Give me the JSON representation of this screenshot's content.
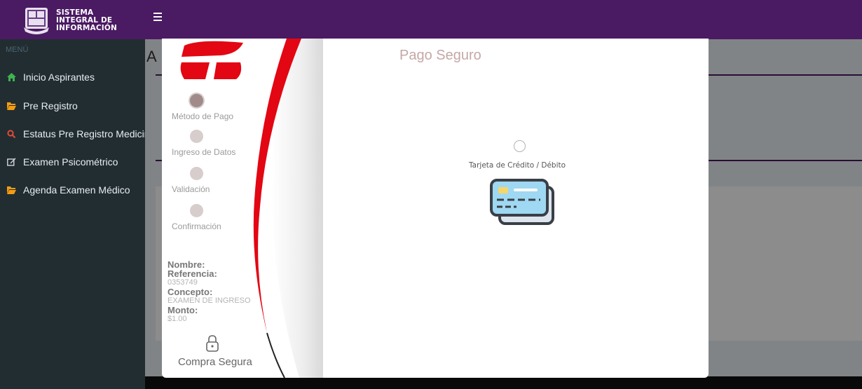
{
  "header": {
    "brand_line1": "SISTEMA",
    "brand_line2": "INTEGRAL DE",
    "brand_line3": "INFORMACIÓN"
  },
  "sidebar": {
    "menu_label": "MENÚ",
    "items": [
      {
        "label": "Inicio Aspirantes",
        "icon": "home-icon",
        "color": "#3fb34f"
      },
      {
        "label": "Pre Registro",
        "icon": "folder-open-icon",
        "color": "#f39c12"
      },
      {
        "label": "Estatus Pre Registro Medicina",
        "icon": "search-icon",
        "color": "#dd4b39"
      },
      {
        "label": "Examen Psicométrico",
        "icon": "edit-icon",
        "color": "#d2d6de"
      },
      {
        "label": "Agenda Examen Médico",
        "icon": "folder-open-icon",
        "color": "#f39c12"
      }
    ]
  },
  "background": {
    "title_partial": "A"
  },
  "modal": {
    "title": "Pago Seguro",
    "steps": [
      {
        "label": "Método de Pago",
        "active": true
      },
      {
        "label": "Ingreso de Datos",
        "active": false
      },
      {
        "label": "Validación",
        "active": false
      },
      {
        "label": "Confirmación",
        "active": false
      }
    ],
    "summary": {
      "nombre_label": "Nombre:",
      "nombre_value": "",
      "referencia_label": "Referencia:",
      "referencia_value": "0353749",
      "concepto_label": "Concepto:",
      "concepto_value": "EXAMEN DE INGRESO",
      "monto_label": "Monto:",
      "monto_value": "$1.00"
    },
    "secure_label": "Compra Segura",
    "payment_option": {
      "label": "Tarjeta de Crédito / Débito",
      "selected": false,
      "icon": "credit-card-icon"
    }
  },
  "colors": {
    "topbar": "#4a1a63",
    "sidebar": "#222d32",
    "accent_red": "#e30613",
    "title": "#c4a8a6"
  }
}
